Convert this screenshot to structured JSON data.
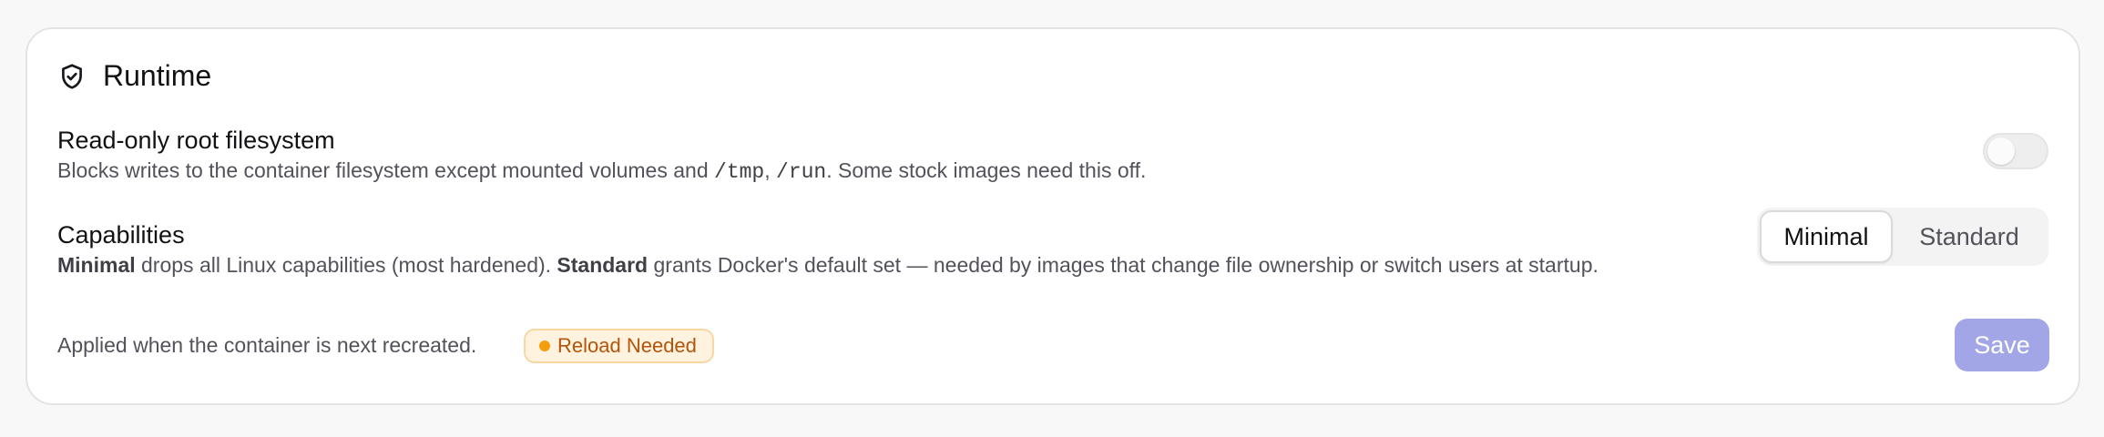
{
  "section": {
    "title": "Runtime",
    "icon": "shield-check-icon"
  },
  "readonly_fs": {
    "title": "Read-only root filesystem",
    "desc_before": "Blocks writes to the container filesystem except mounted volumes and ",
    "code1": "/tmp",
    "desc_sep": ", ",
    "code2": "/run",
    "desc_after": ". Some stock images need this off.",
    "enabled": false
  },
  "capabilities": {
    "title": "Capabilities",
    "opt1_name": "Minimal",
    "opt1_desc": " drops all Linux capabilities (most hardened). ",
    "opt2_name": "Standard",
    "opt2_desc": " grants Docker's default set — needed by images that change file ownership or switch users at startup.",
    "options": [
      "Minimal",
      "Standard"
    ],
    "selected": "Minimal"
  },
  "footer": {
    "note": "Applied when the container is next recreated.",
    "badge": "Reload Needed",
    "save_label": "Save"
  },
  "colors": {
    "accent_disabled": "#a3a6e6",
    "badge_bg": "#fff3df",
    "badge_text": "#b45309",
    "badge_dot": "#f59e0b"
  }
}
